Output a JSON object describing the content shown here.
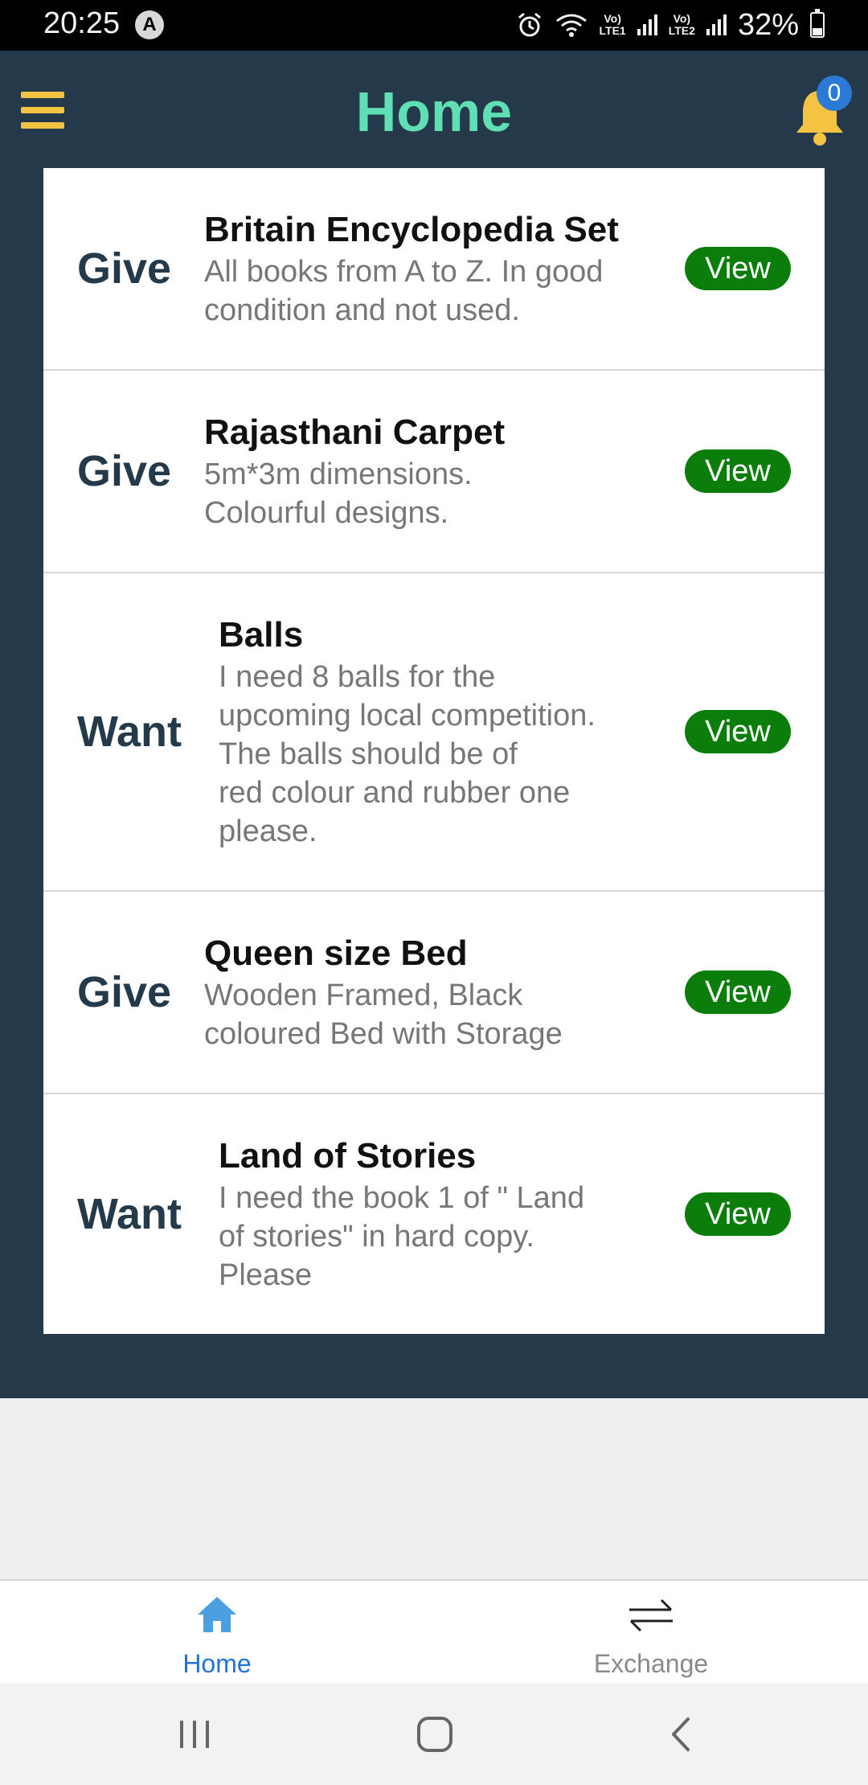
{
  "status_bar": {
    "time": "20:25",
    "app_icon": "A",
    "alarm_icon": "alarm-icon",
    "wifi_icon": "wifi-icon",
    "net1": "Vo)\nLTE1",
    "net2": "Vo)\nLTE2",
    "battery": "32%"
  },
  "header": {
    "title": "Home",
    "menu_icon": "hamburger-menu-icon",
    "bell_icon": "bell-icon",
    "notification_count": "0"
  },
  "items": [
    {
      "kind": "Give",
      "title": "Britain Encyclopedia Set",
      "desc": "All books from A to Z. In good\ncondition and not used.",
      "action": "View"
    },
    {
      "kind": "Give",
      "title": "Rajasthani Carpet",
      "desc": "5m*3m dimensions.\nColourful designs.",
      "action": "View"
    },
    {
      "kind": "Want",
      "title": "Balls",
      "desc": "I need 8 balls for the\nupcoming local competition.\nThe balls should be of\nred colour and rubber one\nplease.",
      "action": "View"
    },
    {
      "kind": "Give",
      "title": "Queen size Bed",
      "desc": "Wooden Framed, Black\ncoloured Bed with Storage",
      "action": "View"
    },
    {
      "kind": "Want",
      "title": "Land of Stories",
      "desc": "I need the book 1 of  \" Land\nof stories\" in hard copy.\nPlease",
      "action": "View"
    }
  ],
  "tabs": [
    {
      "label": "Home",
      "icon": "home-icon",
      "active": true
    },
    {
      "label": "Exchange",
      "icon": "exchange-icon",
      "active": false
    }
  ],
  "colors": {
    "header_bg": "#243a4a",
    "title": "#5fe0b4",
    "menu": "#f5c342",
    "view_button": "#0a7d0a",
    "active_tab": "#1f74d6",
    "inactive_tab": "#8a8a8a"
  }
}
